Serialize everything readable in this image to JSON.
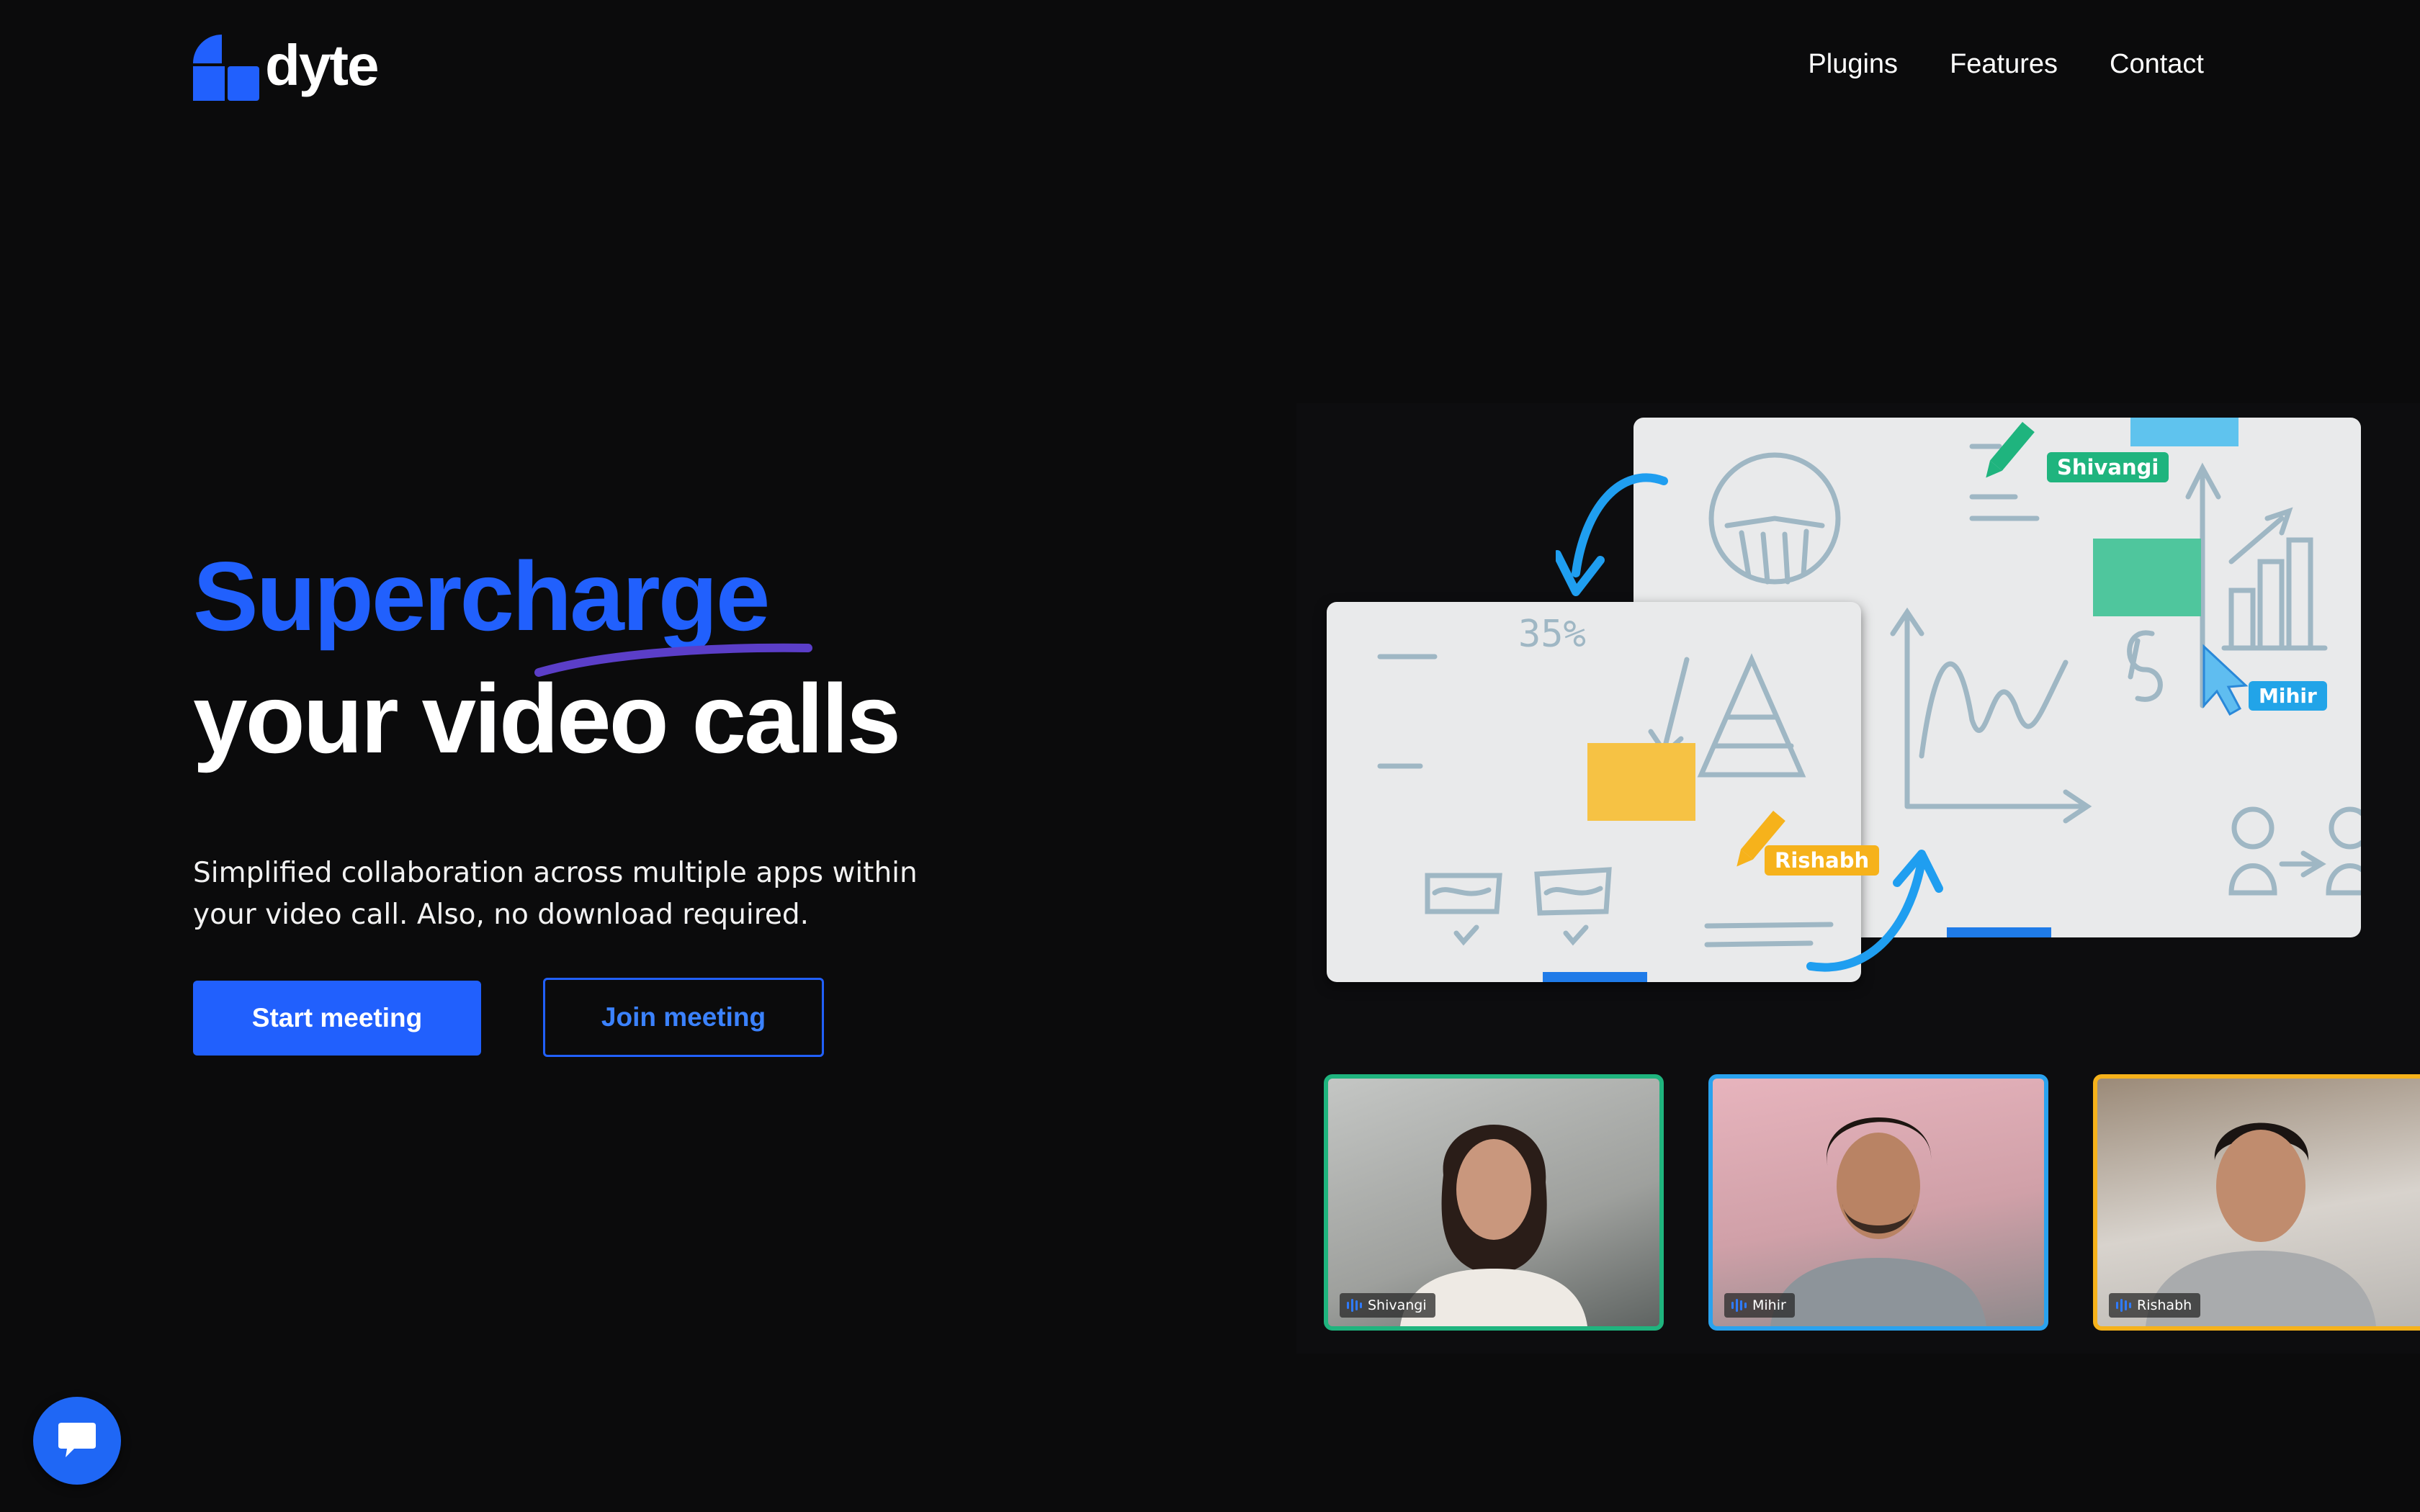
{
  "header": {
    "logo_text": "dyte",
    "nav": [
      {
        "label": "Plugins"
      },
      {
        "label": "Features"
      },
      {
        "label": "Contact"
      }
    ]
  },
  "hero": {
    "title_line1": "Supercharge",
    "title_line2": "your video calls",
    "subtitle": "Simplified collaboration across multiple apps within your video call. Also, no download required.",
    "start_button": "Start meeting",
    "join_button": "Join meeting"
  },
  "illustration": {
    "cursor_tags": [
      "Shivangi",
      "Mihir",
      "Rishabh"
    ],
    "board_text": "35%",
    "participants": [
      {
        "name": "Shivangi",
        "border_color": "#1fb47e"
      },
      {
        "name": "Mihir",
        "border_color": "#2aa2ee"
      },
      {
        "name": "Rishabh",
        "border_color": "#f6b21b"
      }
    ]
  },
  "colors": {
    "brand_blue": "#2160fd",
    "background": "#0b0b0c",
    "underline_purple": "#5b3ec8"
  },
  "icons": {
    "logo": "dyte-logo-icon",
    "chat": "chat-bubble-icon"
  }
}
